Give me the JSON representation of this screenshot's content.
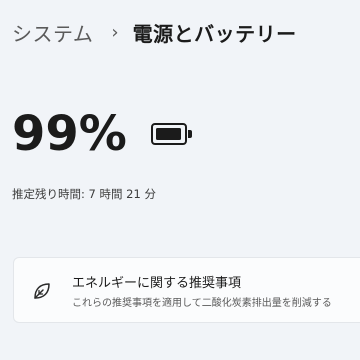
{
  "breadcrumb": {
    "parent": "システム",
    "separator": "›",
    "current": "電源とバッテリー"
  },
  "battery": {
    "percent_label": "99%",
    "level": 0.99,
    "icon": "battery-full-icon"
  },
  "time_remaining": "推定残り時間: 7 時間 21 分",
  "recommendation": {
    "icon": "leaf-icon",
    "title": "エネルギーに関する推奨事項",
    "description": "これらの推奨事項を適用して二酸化炭素排出量を削減する"
  }
}
